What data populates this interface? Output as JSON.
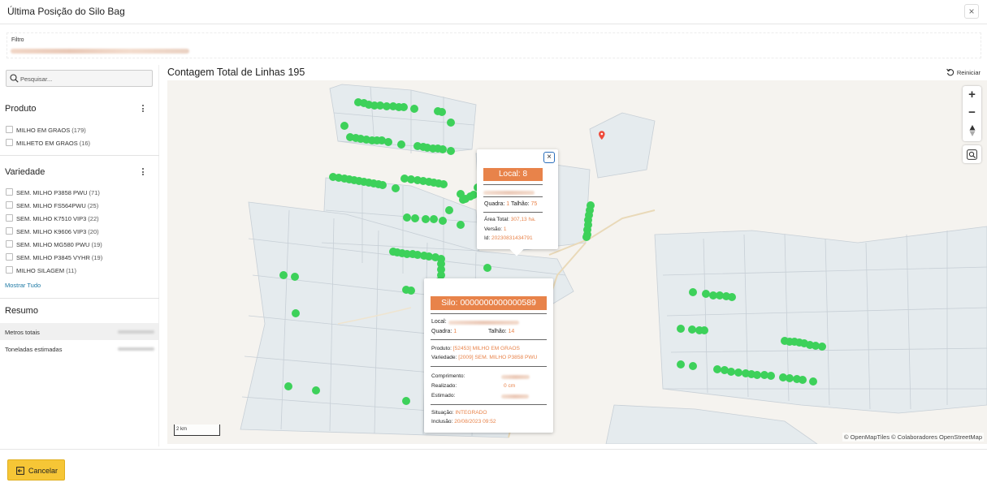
{
  "window": {
    "title": "Última Posição do Silo Bag",
    "close_glyph": "×"
  },
  "filter": {
    "label": "Filtro"
  },
  "sidebar": {
    "search_placeholder": "Pesquisar...",
    "produto": {
      "title": "Produto",
      "items": [
        {
          "label": "MILHO EM GRAOS",
          "count": "(179)"
        },
        {
          "label": "MILHETO EM GRAOS",
          "count": "(16)"
        }
      ]
    },
    "variedade": {
      "title": "Variedade",
      "items": [
        {
          "label": "SEM. MILHO P3858 PWU",
          "count": "(71)"
        },
        {
          "label": "SEM. MILHO FS564PWU",
          "count": "(25)"
        },
        {
          "label": "SEM. MILHO K7510 VIP3",
          "count": "(22)"
        },
        {
          "label": "SEM. MILHO K9606 VIP3",
          "count": "(20)"
        },
        {
          "label": "SEM. MILHO MG580 PWU",
          "count": "(19)"
        },
        {
          "label": "SEM. MILHO P3845 VYHR",
          "count": "(19)"
        },
        {
          "label": "MILHO SILAGEM",
          "count": "(11)"
        }
      ],
      "show_all": "Mostrar Tudo"
    },
    "resumo": {
      "title": "Resumo",
      "rows": [
        {
          "label": "Metros totais"
        },
        {
          "label": "Toneladas estimadas"
        }
      ]
    }
  },
  "map": {
    "title": "Contagem Total de Linhas 195",
    "reset_label": "Reiniciar",
    "zoom_in": "+",
    "zoom_out": "−",
    "scale_label": "2 km",
    "attribution": "© OpenMapTiles  © Colaboradores OpenStreetMap",
    "marker_color": "#3dd15a",
    "accent_color": "#e8834a"
  },
  "popup_local": {
    "header": "Local: 8",
    "quadra_label": "Quadra:",
    "quadra_value": "1",
    "talhao_label": "Talhão:",
    "talhao_value": "75",
    "area_label": "Área Total:",
    "area_value": "307,13 ha.",
    "versao_label": "Versão:",
    "versao_value": "1",
    "id_label": "Id:",
    "id_value": "20230831434791",
    "close_glyph": "×"
  },
  "popup_silo": {
    "header": "Silo: 0000000000000589",
    "local_label": "Local:",
    "quadra_label": "Quadra:",
    "quadra_value": "1",
    "talhao_label": "Talhão:",
    "talhao_value": "14",
    "produto_label": "Produto:",
    "produto_value": "[52453] MILHO EM GRAOS",
    "variedade_label": "Variedade:",
    "variedade_value": "[2009] SEM. MILHO P3858 PWU",
    "comprimento_label": "Comprimento:",
    "realizado_label": "Realizado:",
    "realizado_value": "0 cm",
    "estimado_label": "Estimado:",
    "situacao_label": "Situação:",
    "situacao_value": "INTEGRADO",
    "inclusao_label": "Inclusão:",
    "inclusao_value": "20/08/2023 09:52"
  },
  "footer": {
    "cancel_label": "Cancelar"
  }
}
